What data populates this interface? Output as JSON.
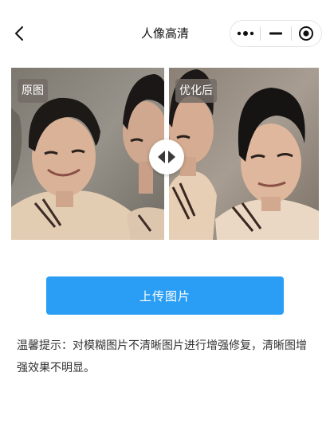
{
  "header": {
    "title": "人像高清"
  },
  "compare": {
    "before_label": "原图",
    "after_label": "优化后"
  },
  "upload_button": {
    "label": "上传图片"
  },
  "tip": {
    "text": "温馨提示：对模糊图片不清晰图片进行增强修复，清晰图增强效果不明显。"
  }
}
